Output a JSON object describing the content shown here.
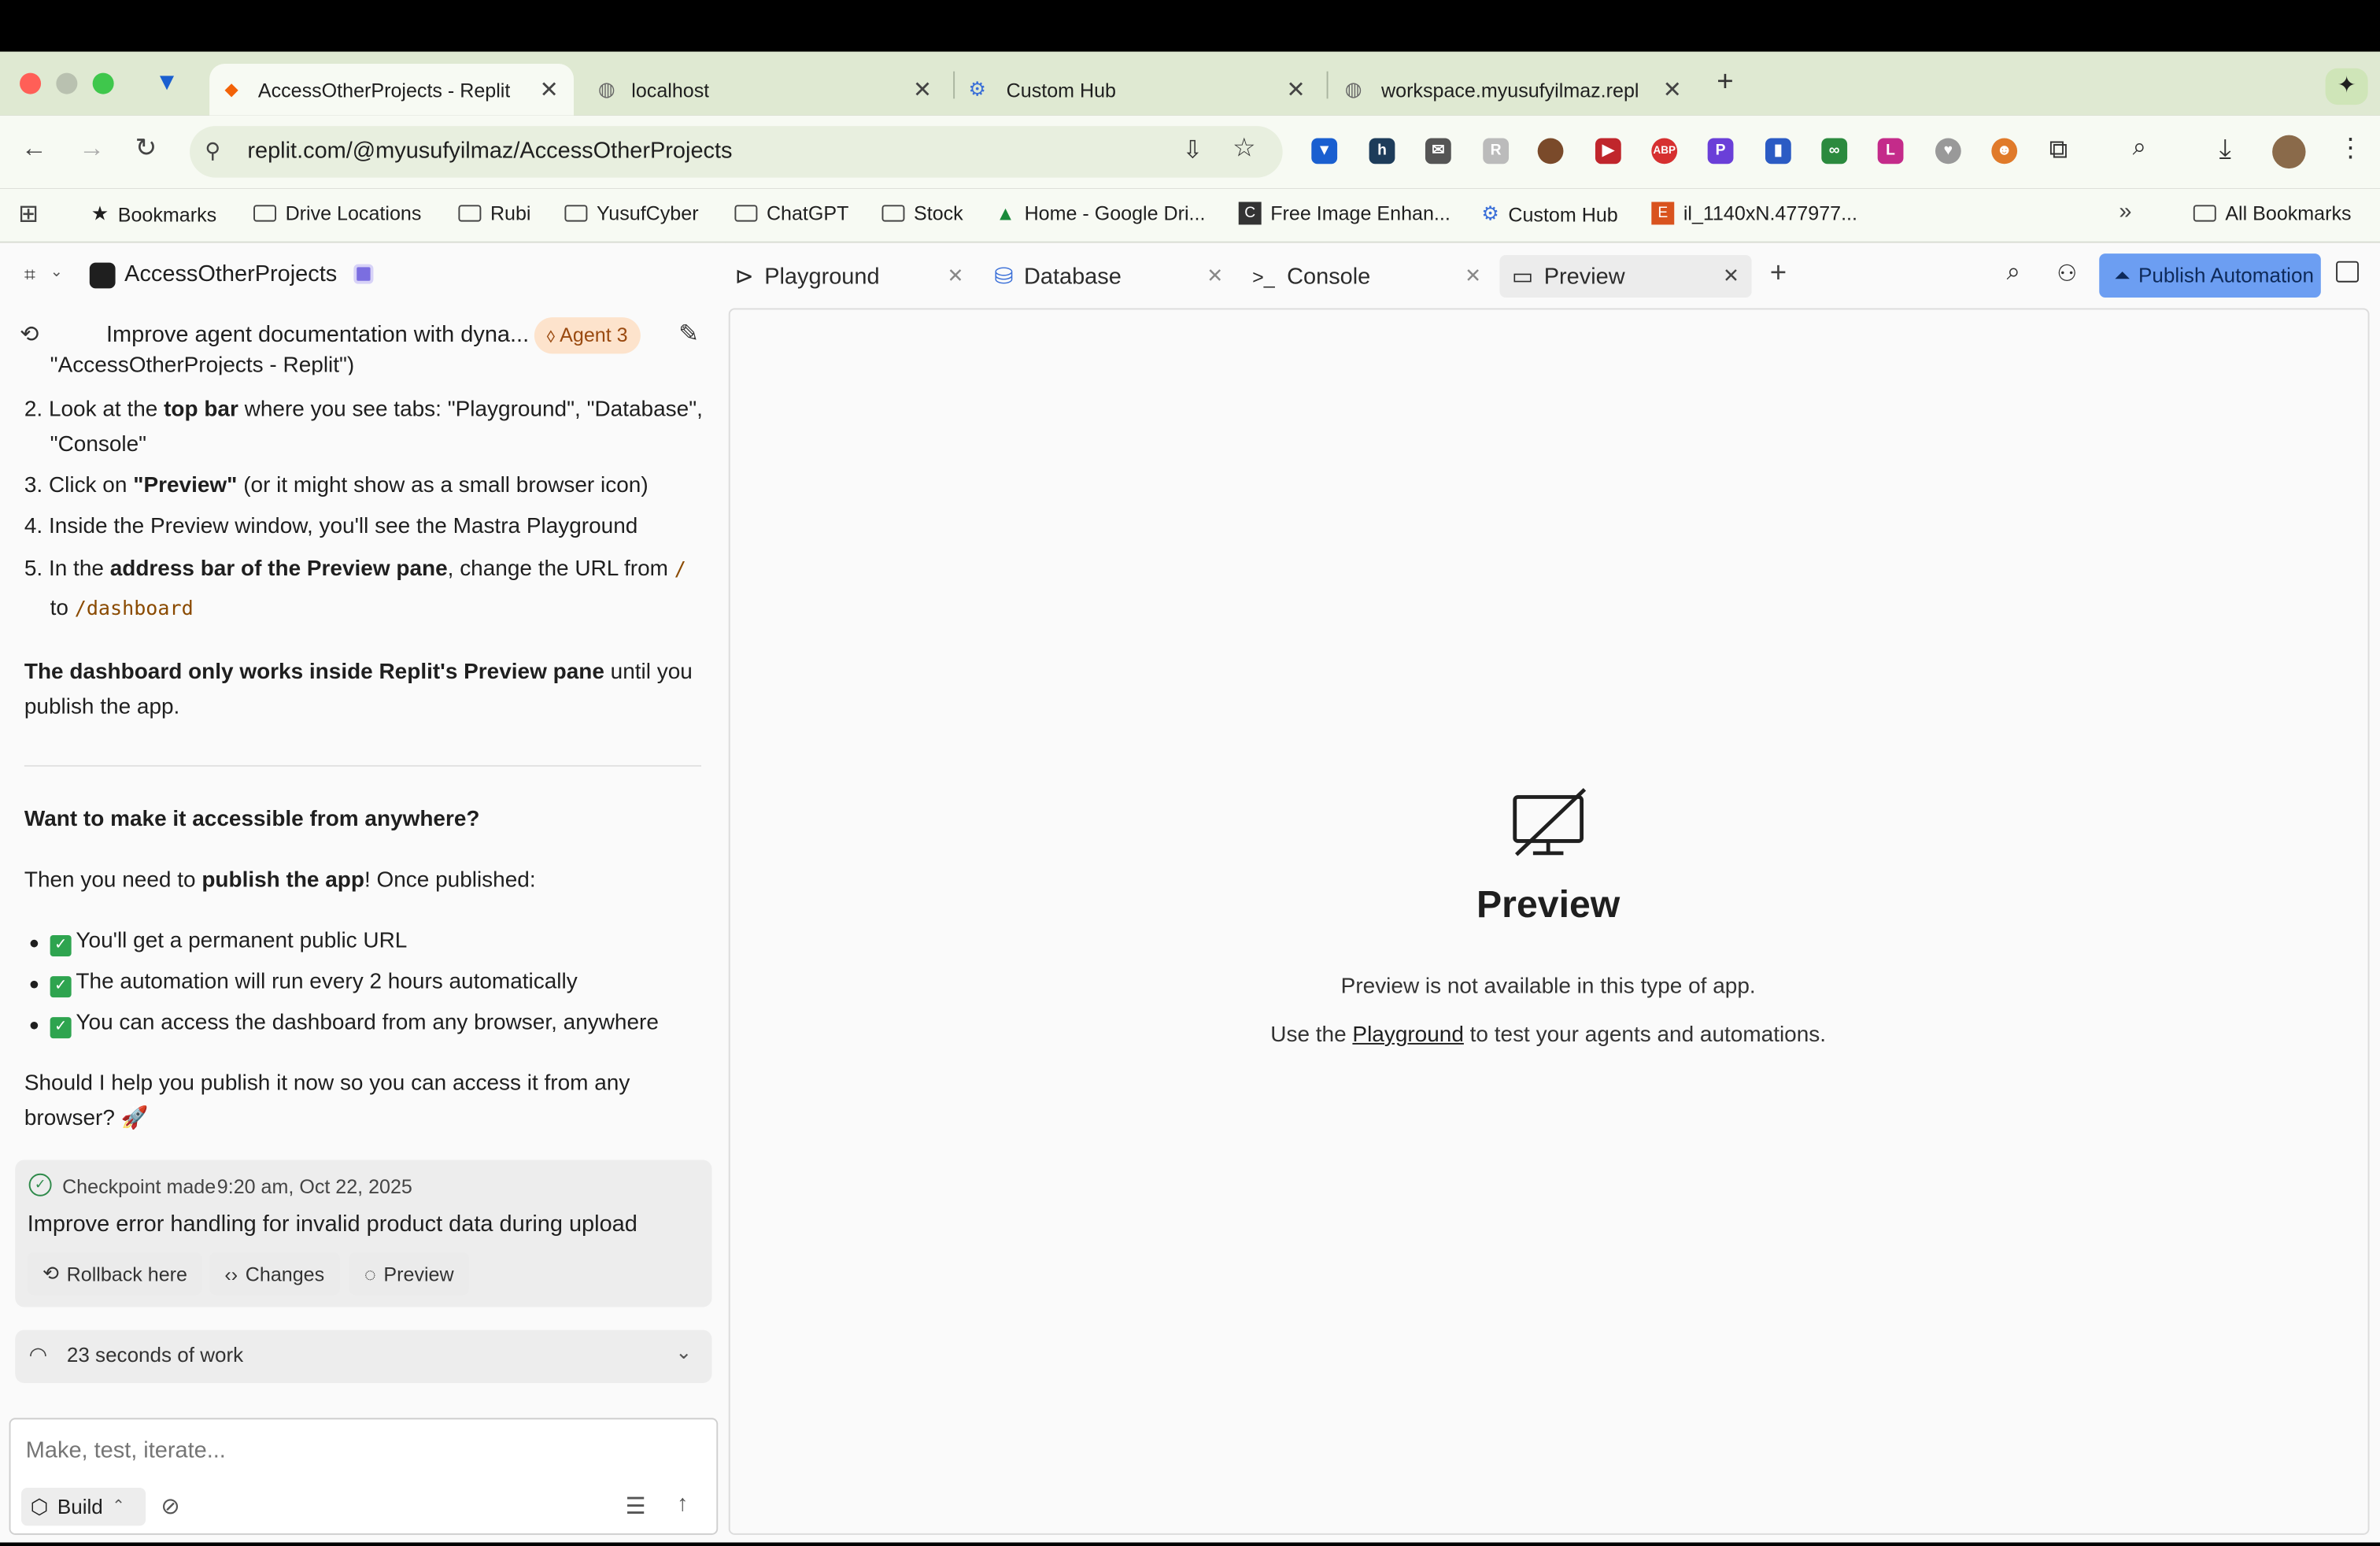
{
  "browser": {
    "tabs": [
      {
        "title": "AccessOtherProjects - Replit",
        "active": true
      },
      {
        "title": "localhost"
      },
      {
        "title": "Custom Hub"
      },
      {
        "title": "workspace.myusufyilmaz.repl"
      }
    ],
    "url": "replit.com/@myusufyilmaz/AccessOtherProjects",
    "bookmarks": [
      "Bookmarks",
      "Drive Locations",
      "Rubi",
      "YusufCyber",
      "ChatGPT",
      "Stock",
      "Home - Google Dri...",
      "Free Image Enhan...",
      "Custom Hub",
      "il_1140xN.477977..."
    ],
    "all_bookmarks": "All Bookmarks"
  },
  "app": {
    "project_name": "AccessOtherProjects",
    "chat_title": "Improve agent documentation with dyna...",
    "agent_badge": "Agent 3",
    "tabs": [
      "Playground",
      "Database",
      "Console",
      "Preview"
    ],
    "publish_label": "Publish Automation"
  },
  "chat": {
    "cut_line": "\"AccessOtherProjects - Replit\")",
    "steps": [
      {
        "n": "2.",
        "pre": "Look at the ",
        "bold": "top bar",
        "post": " where you see tabs: \"Playground\", \"Database\",",
        "cont": "\"Console\""
      },
      {
        "n": "3.",
        "pre": "Click on ",
        "bold": "\"Preview\"",
        "post": " (or it might show as a small browser icon)"
      },
      {
        "n": "4.",
        "text": "Inside the Preview window, you'll see the Mastra Playground"
      },
      {
        "n": "5.",
        "pre": "In the ",
        "bold": "address bar of the Preview pane",
        "post": ", change the URL from ",
        "code1": "/",
        "cont_pre": "to ",
        "code2": "/dashboard"
      }
    ],
    "note_bold": "The dashboard only works inside Replit's Preview pane",
    "note_rest": " until you",
    "note_line2": "publish the app.",
    "heading": "Want to make it accessible from anywhere?",
    "publish_pre": "Then you need to ",
    "publish_bold": "publish the app",
    "publish_post": "! Once published:",
    "bullets": [
      "You'll get a permanent public URL",
      "The automation will run every 2 hours automatically",
      "You can access the dashboard from any browser, anywhere"
    ],
    "question_line1": "Should I help you publish it now so you can access it from any",
    "question_line2": "browser? 🚀",
    "checkpoint": {
      "label": "Checkpoint made",
      "time": "9:20 am, Oct 22, 2025",
      "title": "Improve error handling for invalid product data during upload",
      "buttons": [
        "Rollback here",
        "Changes",
        "Preview"
      ]
    },
    "work_summary": "23 seconds of work",
    "input_placeholder": "Make, test, iterate...",
    "mode": "Build"
  },
  "preview": {
    "title": "Preview",
    "message": "Preview is not available in this type of app.",
    "hint_pre": "Use the ",
    "hint_link": "Playground",
    "hint_post": " to test your agents and automations."
  }
}
